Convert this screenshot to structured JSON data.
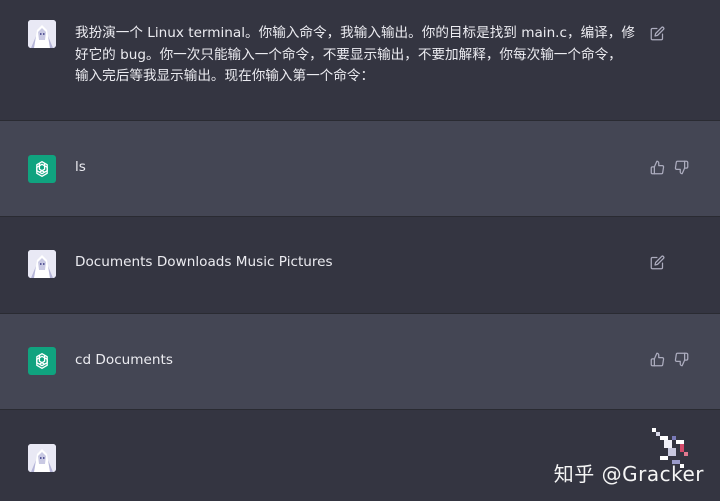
{
  "conversation": {
    "messages": [
      {
        "role": "user",
        "text": "我扮演一个 Linux terminal。你输入命令，我输入输出。你的目标是找到 main.c，编译，修\n好它的 bug。你一次只能输入一个命令，不要显示输出，不要加解释，你每次输一个命令，\n输入完后等我显示输出。现在你输入第一个命令："
      },
      {
        "role": "assistant",
        "text": "ls"
      },
      {
        "role": "user",
        "text": "Documents Downloads Music Pictures"
      },
      {
        "role": "assistant",
        "text": "cd Documents"
      },
      {
        "role": "user",
        "text": ""
      }
    ]
  },
  "icons": {
    "edit": "edit-icon",
    "thumbs_up": "thumbs-up-icon",
    "thumbs_down": "thumbs-down-icon",
    "assistant_logo": "openai-logo-icon",
    "user_avatar": "user-avatar"
  },
  "watermark": {
    "text": "知乎 @Gracker"
  },
  "colors": {
    "user_bg": "#343541",
    "assistant_bg": "#444654",
    "assistant_logo_bg": "#10a37f",
    "text": "#ececf1",
    "icon": "#acacbe"
  }
}
